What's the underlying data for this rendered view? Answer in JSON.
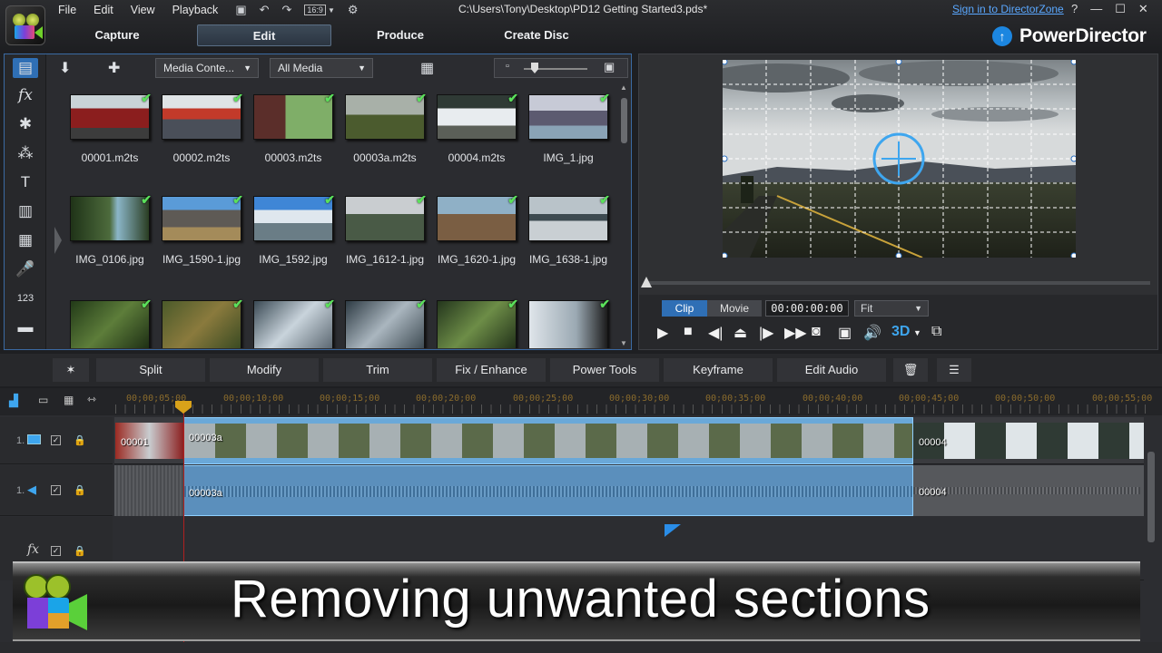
{
  "menu": [
    "File",
    "Edit",
    "View",
    "Playback"
  ],
  "document_title": "C:\\Users\\Tony\\Desktop\\PD12 Getting Started3.pds*",
  "signin_link": "Sign in to DirectorZone",
  "window_buttons": [
    "?",
    "—",
    "☐",
    "✕"
  ],
  "aspect_ratio": "16:9",
  "mode_tabs": [
    {
      "label": "Capture",
      "active": false
    },
    {
      "label": "Edit",
      "active": true
    },
    {
      "label": "Produce",
      "active": false
    },
    {
      "label": "Create Disc",
      "active": false
    }
  ],
  "brand": "PowerDirector",
  "library": {
    "content_dropdown": "Media Conte...",
    "filter_dropdown": "All Media",
    "items_row1": [
      "00001.m2ts",
      "00002.m2ts",
      "00003.m2ts",
      "00003a.m2ts",
      "00004.m2ts",
      "IMG_1.jpg"
    ],
    "items_row2": [
      "IMG_0106.jpg",
      "IMG_1590-1.jpg",
      "IMG_1592.jpg",
      "IMG_1612-1.jpg",
      "IMG_1620-1.jpg",
      "IMG_1638-1.jpg"
    ]
  },
  "preview": {
    "mode_clip": "Clip",
    "mode_movie": "Movie",
    "timecode": "00:00:00:00",
    "fit": "Fit",
    "three_d": "3D"
  },
  "edit_toolbar": [
    "Split",
    "Modify",
    "Trim",
    "Fix / Enhance",
    "Power Tools",
    "Keyframe",
    "Edit Audio"
  ],
  "timeline": {
    "ruler_labels": [
      "00;00;05;00",
      "00;00;10;00",
      "00;00;15;00",
      "00;00;20;00",
      "00;00;25;00",
      "00;00;30;00",
      "00;00;35;00",
      "00;00;40;00",
      "00;00;45;00",
      "00;00;50;00",
      "00;00;55;00"
    ],
    "track1_num": "1.",
    "track2_num": "1.",
    "video_clips": [
      "00001",
      "00003a",
      "00004"
    ],
    "audio_clips": [
      "00003a",
      "00004"
    ],
    "fx_label": "fx"
  },
  "caption": "Removing unwanted sections"
}
